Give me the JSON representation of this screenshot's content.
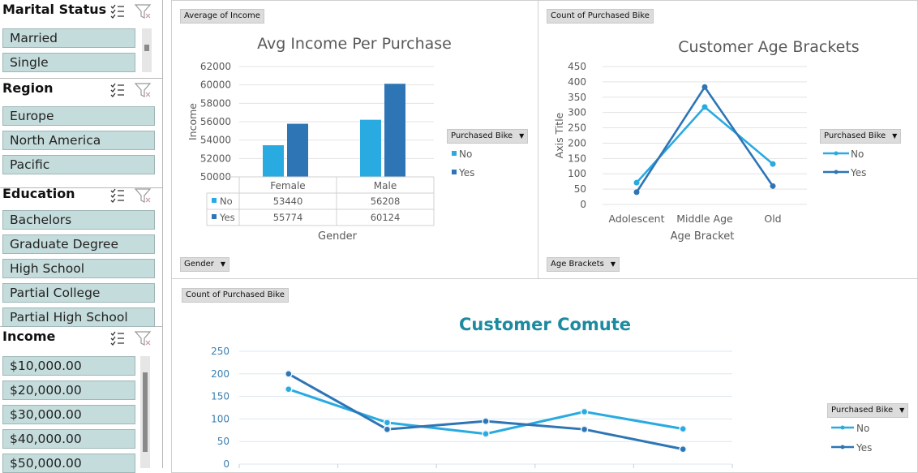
{
  "slicers": {
    "marital": {
      "title": "Marital Status",
      "items": [
        "Married",
        "Single"
      ]
    },
    "region": {
      "title": "Region",
      "items": [
        "Europe",
        "North America",
        "Pacific"
      ]
    },
    "education": {
      "title": "Education",
      "items": [
        "Bachelors",
        "Graduate Degree",
        "High School",
        "Partial College",
        "Partial High School"
      ]
    },
    "income": {
      "title": "Income",
      "items": [
        "$10,000.00",
        "$20,000.00",
        "$30,000.00",
        "$40,000.00",
        "$50,000.00"
      ]
    }
  },
  "field_buttons": {
    "avg_income": "Average of Income",
    "count_bike_1": "Count of Purchased Bike",
    "count_bike_2": "Count of Purchased Bike",
    "gender": "Gender",
    "age_brackets": "Age Brackets",
    "legend_1": "Purchased Bike",
    "legend_2": "Purchased Bike",
    "legend_3": "Purchased Bike"
  },
  "colors": {
    "no": "#29aae1",
    "yes": "#2e75b6",
    "title_teal": "#1e8aa0"
  },
  "chart_data": [
    {
      "type": "bar",
      "title": "Avg Income Per Purchase",
      "xlabel": "Gender",
      "ylabel": "Income",
      "categories": [
        "Female",
        "Male"
      ],
      "series": [
        {
          "name": "No",
          "values": [
            53440,
            56208
          ]
        },
        {
          "name": "Yes",
          "values": [
            55774,
            60124
          ]
        }
      ],
      "ylim": [
        50000,
        62000
      ],
      "yticks": [
        "62000",
        "60000",
        "58000",
        "56000",
        "54000",
        "52000",
        "50000"
      ],
      "table": {
        "no_label": "No",
        "yes_label": "Yes",
        "no_values": [
          "53440",
          "56208"
        ],
        "yes_values": [
          "55774",
          "60124"
        ]
      },
      "legend_position": "right",
      "grid": true
    },
    {
      "type": "line",
      "title": "Customer Age Brackets",
      "xlabel": "Age Bracket",
      "ylabel": "Axis Title",
      "categories": [
        "Adolescent",
        "Middle Age",
        "Old"
      ],
      "series": [
        {
          "name": "No",
          "values": [
            71,
            318,
            132
          ]
        },
        {
          "name": "Yes",
          "values": [
            40,
            383,
            60
          ]
        }
      ],
      "ylim": [
        0,
        450
      ],
      "yticks": [
        "450",
        "400",
        "350",
        "300",
        "250",
        "200",
        "150",
        "100",
        "50",
        "0"
      ],
      "legend_position": "right",
      "grid": true
    },
    {
      "type": "line",
      "title": "Customer Comute",
      "categories": [
        "",
        "",
        "",
        "",
        ""
      ],
      "series": [
        {
          "name": "No",
          "values": [
            166,
            92,
            67,
            116,
            78
          ]
        },
        {
          "name": "Yes",
          "values": [
            200,
            77,
            95,
            77,
            33
          ]
        }
      ],
      "ylim": [
        0,
        250
      ],
      "yticks": [
        "250",
        "200",
        "150",
        "100",
        "50",
        "0"
      ],
      "legend_position": "right",
      "grid": true
    }
  ]
}
